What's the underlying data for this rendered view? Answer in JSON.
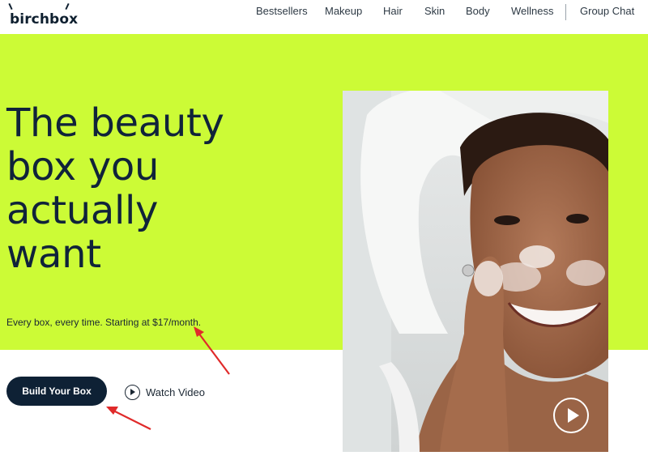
{
  "brand": {
    "logo_text": "birchbox"
  },
  "nav": {
    "items": [
      {
        "label": "Bestsellers"
      },
      {
        "label": "Makeup"
      },
      {
        "label": "Hair"
      },
      {
        "label": "Skin"
      },
      {
        "label": "Body"
      },
      {
        "label": "Wellness"
      }
    ],
    "group_chat": "Group Chat"
  },
  "hero": {
    "title_lines": [
      "The beauty",
      "box you",
      "actually",
      "want"
    ],
    "subtitle": "Every box, every time. Starting at $17/month.",
    "primary_button": "Build Your Box",
    "secondary_button": "Watch Video"
  },
  "colors": {
    "hero_background": "#ccfb36",
    "primary_button_bg": "#0e2135",
    "text_dark": "#10233a",
    "annotation_arrow": "#e02a2a"
  },
  "icons": {
    "watch_video": "play-circle-icon",
    "hero_video": "play-circle-icon"
  }
}
